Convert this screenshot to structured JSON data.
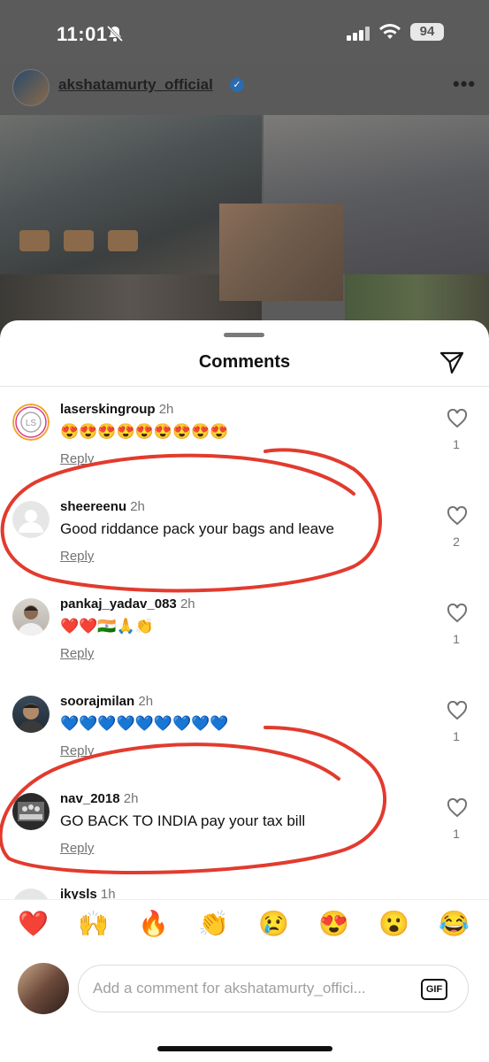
{
  "status_bar": {
    "time": "11:01",
    "battery": "94"
  },
  "post": {
    "username": "akshatamurty_official"
  },
  "sheet": {
    "title": "Comments"
  },
  "comments": [
    {
      "user": "laserskingroup",
      "time": "2h",
      "text": "😍😍😍😍😍😍😍😍😍",
      "reply": "Reply",
      "likes": "1"
    },
    {
      "user": "sheereenu",
      "time": "2h",
      "text": "Good riddance pack your bags and leave",
      "reply": "Reply",
      "likes": "2"
    },
    {
      "user": "pankaj_yadav_083",
      "time": "2h",
      "text": "❤️❤️🇮🇳🙏👏",
      "reply": "Reply",
      "likes": "1"
    },
    {
      "user": "soorajmilan",
      "time": "2h",
      "text": "💙💙💙💙💙💙💙💙💙",
      "reply": "Reply",
      "likes": "1"
    },
    {
      "user": "nav_2018",
      "time": "2h",
      "text": "GO BACK TO INDIA pay your tax bill",
      "reply": "Reply",
      "likes": "1"
    },
    {
      "user": "ikysls",
      "time": "1h"
    }
  ],
  "quick_emojis": [
    "❤️",
    "🙌",
    "🔥",
    "👏",
    "😢",
    "😍",
    "😮",
    "😂"
  ],
  "composer": {
    "placeholder": "Add a comment for akshatamurty_offici...",
    "gif_label": "GIF"
  },
  "colors": {
    "annotation": "#e23b2e",
    "verified": "#2b6bb0"
  },
  "icons": {
    "share": "paper-plane-icon",
    "like": "heart-outline-icon",
    "notifications": "bell-slash-icon"
  }
}
